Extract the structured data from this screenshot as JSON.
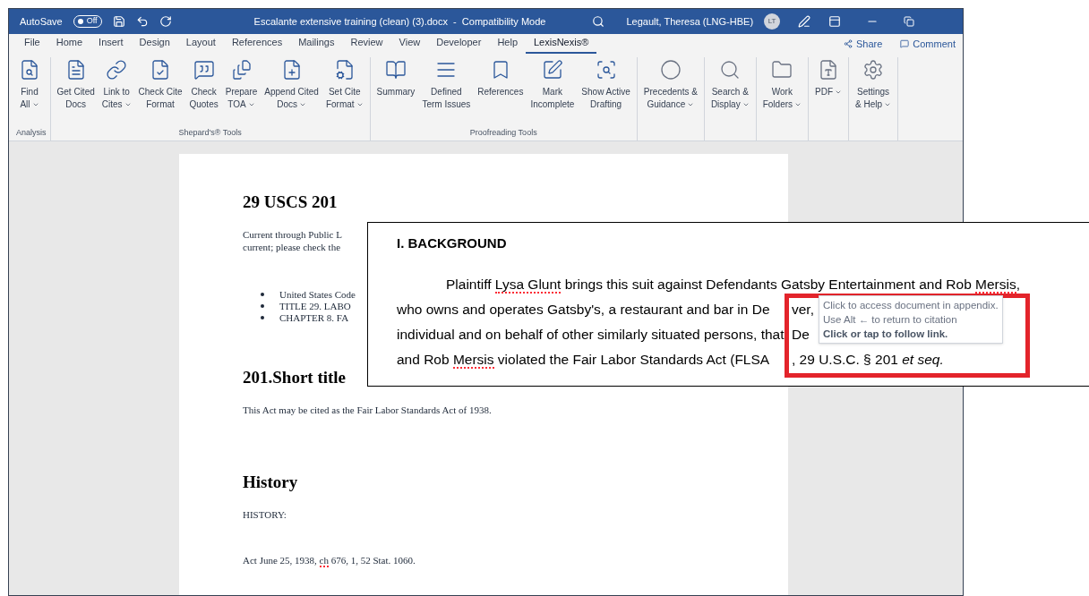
{
  "title_bar": {
    "autosave_label": "AutoSave",
    "autosave_toggle": {
      "label": "Off",
      "on": false
    },
    "document_title": "Escalante extensive training (clean) (3).docx  -  Compatibility Mode",
    "user_name": "Legault, Theresa (LNG-HBE)",
    "avatar_initials": "LT"
  },
  "tabs": [
    {
      "label": "File",
      "selected": false
    },
    {
      "label": "Home",
      "selected": false
    },
    {
      "label": "Insert",
      "selected": false
    },
    {
      "label": "Design",
      "selected": false
    },
    {
      "label": "Layout",
      "selected": false
    },
    {
      "label": "References",
      "selected": false
    },
    {
      "label": "Mailings",
      "selected": false
    },
    {
      "label": "Review",
      "selected": false
    },
    {
      "label": "View",
      "selected": false
    },
    {
      "label": "Developer",
      "selected": false
    },
    {
      "label": "Help",
      "selected": false
    },
    {
      "label": "LexisNexis®",
      "selected": true
    }
  ],
  "share_button": "Share",
  "comments_button": "Comment",
  "ribbon": {
    "groups": [
      {
        "name": "Analysis",
        "buttons": [
          {
            "lines": [
              "Find",
              "All"
            ],
            "dropdown": true
          }
        ]
      },
      {
        "name": "Shepard's® Tools",
        "buttons": [
          {
            "lines": [
              "Get Cited",
              "Docs"
            ],
            "dropdown": false
          },
          {
            "lines": [
              "Link to",
              "Cites"
            ],
            "dropdown": true
          },
          {
            "lines": [
              "Check Cite",
              "Format"
            ],
            "dropdown": false
          },
          {
            "lines": [
              "Check",
              "Quotes"
            ],
            "dropdown": false
          },
          {
            "lines": [
              "Prepare",
              "TOA"
            ],
            "dropdown": true
          },
          {
            "lines": [
              "Append Cited",
              "Docs"
            ],
            "dropdown": true
          },
          {
            "lines": [
              "Set Cite",
              "Format"
            ],
            "dropdown": true
          }
        ]
      },
      {
        "name": "Proofreading Tools",
        "buttons": [
          {
            "lines": [
              "Summary"
            ],
            "dropdown": false
          },
          {
            "lines": [
              "Defined",
              "Term Issues"
            ],
            "dropdown": false
          },
          {
            "lines": [
              "References"
            ],
            "dropdown": false
          },
          {
            "lines": [
              "Mark",
              "Incomplete"
            ],
            "dropdown": false
          },
          {
            "lines": [
              "Show Active",
              "Drafting"
            ],
            "dropdown": false
          }
        ]
      },
      {
        "buttons": [
          {
            "lines": [
              "Precedents &",
              "Guidance"
            ],
            "dropdown": true
          }
        ]
      },
      {
        "buttons": [
          {
            "lines": [
              "Search &",
              "Display"
            ],
            "dropdown": true
          }
        ]
      },
      {
        "buttons": [
          {
            "lines": [
              "Work",
              "Folders"
            ],
            "dropdown": true
          }
        ]
      },
      {
        "buttons": [
          {
            "lines": [
              "PDF"
            ],
            "dropdown": true
          }
        ]
      },
      {
        "buttons": [
          {
            "lines": [
              "Settings",
              "& Help"
            ],
            "dropdown": true
          }
        ]
      }
    ]
  },
  "document": {
    "heading": "29 USCS 201",
    "intro_lines": [
      "Current through Public L",
      "current; please check the"
    ],
    "bullets": [
      "United States Code",
      "TITLE 29. LABO",
      "CHAPTER 8. FA"
    ],
    "section_heading": "201.Short title",
    "section_text": "This Act may be cited as the Fair Labor Standards Act of 1938.",
    "history_heading": "History",
    "history_label": "HISTORY:",
    "history_text": [
      {
        "text": "Act June 25, 1938, ",
        "misspelled": false
      },
      {
        "text": "ch",
        "misspelled": true
      },
      {
        "text": " 676, 1, 52 Stat. 1060.",
        "misspelled": false
      }
    ]
  },
  "excerpt": {
    "heading": "I. BACKGROUND",
    "lines": [
      [
        {
          "text": "Plaintiff ",
          "misspelled": false
        },
        {
          "text": "Lysa Glunt",
          "misspelled": true
        },
        {
          "text": " brings this suit against Defendants Gatsby Entertainment and Rob ",
          "misspelled": false
        },
        {
          "text": "Mersis",
          "misspelled": true
        },
        {
          "text": ",",
          "misspelled": false
        }
      ],
      [
        {
          "text": "who owns and operates Gatsby's, a restaurant and bar in De",
          "misspelled": false
        },
        {
          "text": "ver,",
          "misspelled": false,
          "past_frame": true
        }
      ],
      [
        {
          "text": "individual and on behalf of other similarly situated persons, that",
          "misspelled": false
        },
        {
          "text": "De",
          "misspelled": false,
          "past_frame": true
        }
      ],
      [
        {
          "text": "and Rob ",
          "misspelled": false
        },
        {
          "text": "Mersis",
          "misspelled": true
        },
        {
          "text": " violated the Fair Labor Standards Act (FLSA",
          "misspelled": false
        },
        {
          "text": ", 29 U.S.C. § 201 *et seq.*",
          "misspelled": false,
          "past_frame": true
        }
      ]
    ]
  },
  "tooltip": {
    "lines": [
      {
        "text": "Click to access document in appendix.",
        "bold": false
      },
      {
        "text": "Use Alt ← to return to citation",
        "bold": false
      },
      {
        "text": "Click or tap to follow link.",
        "bold": true
      }
    ]
  }
}
